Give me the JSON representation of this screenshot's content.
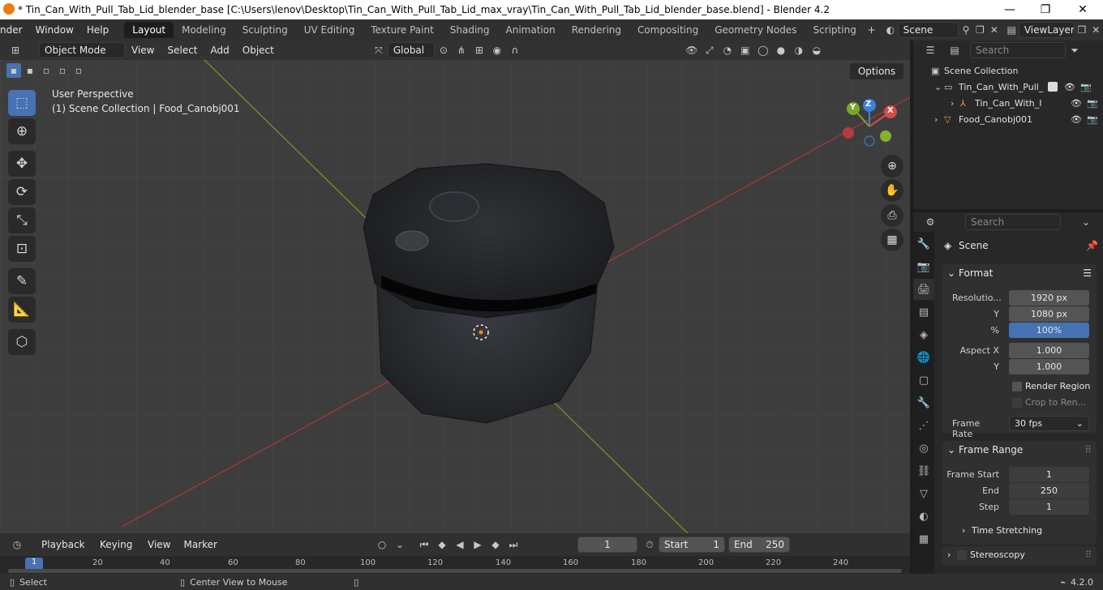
{
  "window": {
    "title": "* Tin_Can_With_Pull_Tab_Lid_blender_base [C:\\Users\\lenov\\Desktop\\Tin_Can_With_Pull_Tab_Lid_max_vray\\Tin_Can_With_Pull_Tab_Lid_blender_base.blend] - Blender 4.2",
    "minimize": "—",
    "maximize": "❐",
    "close": "✕"
  },
  "menus": [
    "nder",
    "Window",
    "Help"
  ],
  "workspaces": [
    "Layout",
    "Modeling",
    "Sculpting",
    "UV Editing",
    "Texture Paint",
    "Shading",
    "Animation",
    "Rendering",
    "Compositing",
    "Geometry Nodes",
    "Scripting"
  ],
  "scene": {
    "name": "Scene",
    "view_layer": "ViewLayer"
  },
  "viewport_header": {
    "mode": "Object Mode",
    "menus": [
      "View",
      "Select",
      "Add",
      "Object"
    ],
    "transform_orientation": "Global",
    "options": "Options"
  },
  "viewport": {
    "perspective": "User Perspective",
    "collection_info": "(1) Scene Collection | Food_Canobj001",
    "gizmo": {
      "x": "X",
      "y": "Y",
      "z": "Z"
    }
  },
  "outliner": {
    "search_placeholder": "Search",
    "root": "Scene Collection",
    "items": [
      {
        "label": "Tin_Can_With_Pull_"
      },
      {
        "label": "Tin_Can_With_I"
      },
      {
        "label": "Food_Canobj001"
      }
    ]
  },
  "properties": {
    "search_placeholder": "Search",
    "context": "Scene",
    "format_panel": {
      "title": "Format",
      "resolution_label": "Resolutio...",
      "res_x": "1920 px",
      "y_label": "Y",
      "res_y": "1080 px",
      "pct_label": "%",
      "res_pct": "100%",
      "aspect_x_label": "Aspect X",
      "aspect_x": "1.000",
      "aspect_y": "1.000",
      "render_region": "Render Region",
      "crop": "Crop to Ren...",
      "frame_rate_label": "Frame Rate",
      "frame_rate": "30 fps"
    },
    "frame_range_panel": {
      "title": "Frame Range",
      "start_label": "Frame Start",
      "start": "1",
      "end_label": "End",
      "end": "250",
      "step_label": "Step",
      "step": "1",
      "time_stretching": "Time Stretching"
    },
    "stereoscopy": "Stereoscopy"
  },
  "timeline": {
    "menus": [
      "Playback",
      "Keying",
      "View",
      "Marker"
    ],
    "current_frame": "1",
    "start_label": "Start",
    "start": "1",
    "end_label": "End",
    "end": "250",
    "ruler": [
      "1",
      "20",
      "40",
      "60",
      "80",
      "100",
      "120",
      "140",
      "160",
      "180",
      "200",
      "220",
      "240"
    ]
  },
  "statusbar": {
    "select": "Select",
    "center": "Center View to Mouse",
    "version": "4.2.0"
  }
}
